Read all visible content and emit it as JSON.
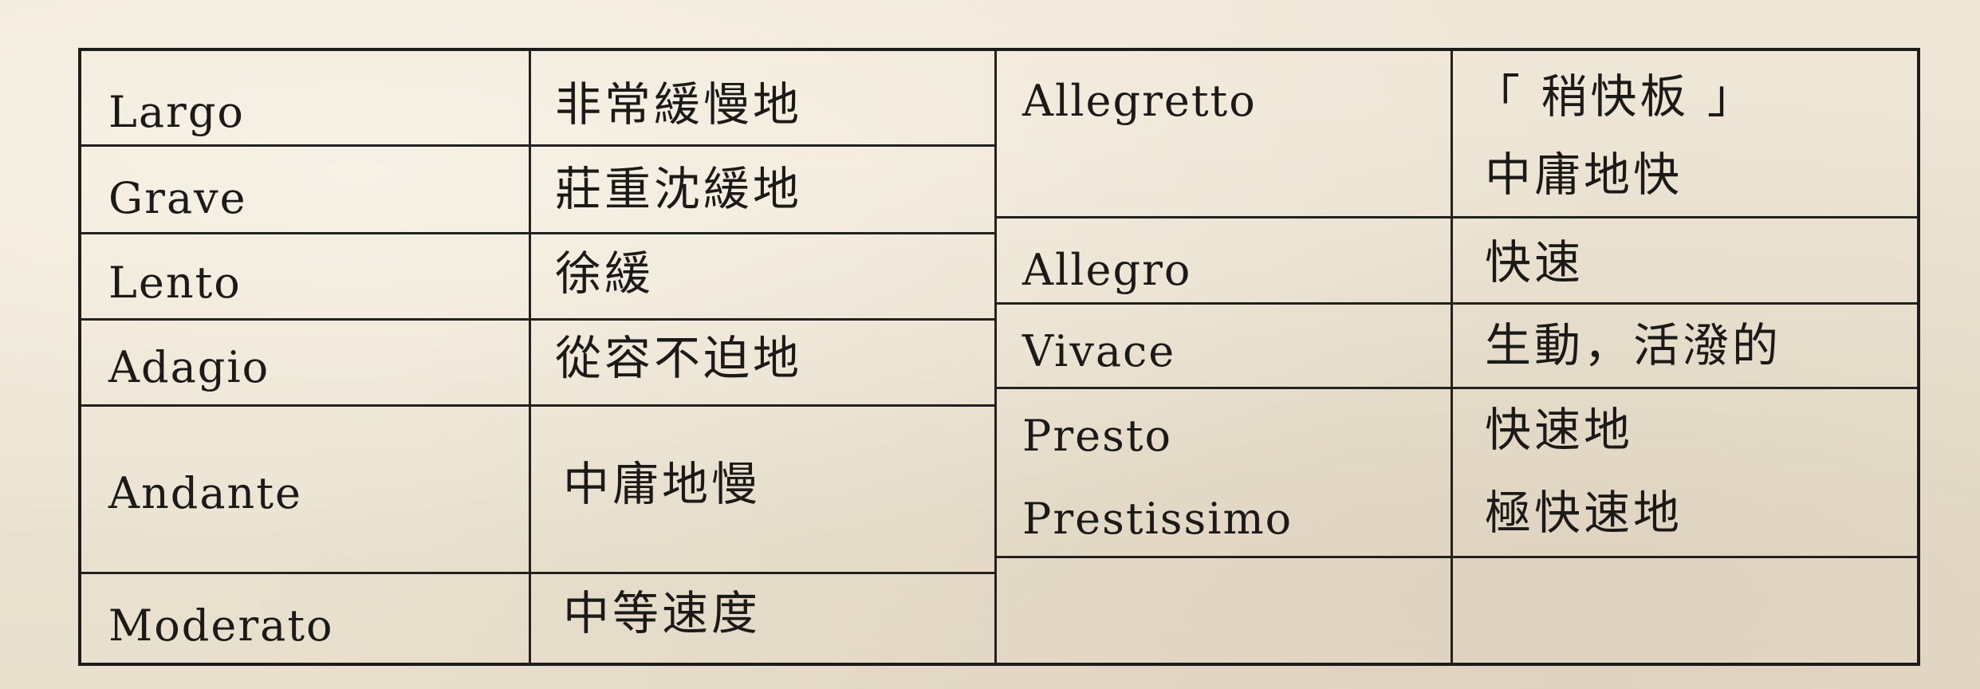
{
  "rows_left": [
    {
      "term": "Largo",
      "meaning": "非常緩慢地"
    },
    {
      "term": "Grave",
      "meaning": "莊重沈緩地"
    },
    {
      "term": "Lento",
      "meaning": "徐緩"
    },
    {
      "term": "Adagio",
      "meaning": "從容不迫地"
    },
    {
      "term": "Andante",
      "meaning": "中庸地慢"
    },
    {
      "term": "Moderato",
      "meaning": "中等速度"
    }
  ],
  "rows_right": [
    {
      "term": "Allegretto",
      "meaning_line1": "「 稍快板 」",
      "meaning_line2": "中庸地快"
    },
    {
      "term": "Allegro",
      "meaning": "快速"
    },
    {
      "term": "Vivace",
      "meaning": "生動，活潑的"
    },
    {
      "term_line1": "Presto",
      "term_line2": "Prestissimo",
      "meaning_line1": "快速地",
      "meaning_line2": "極快速地"
    },
    {
      "term": "",
      "meaning": ""
    }
  ]
}
